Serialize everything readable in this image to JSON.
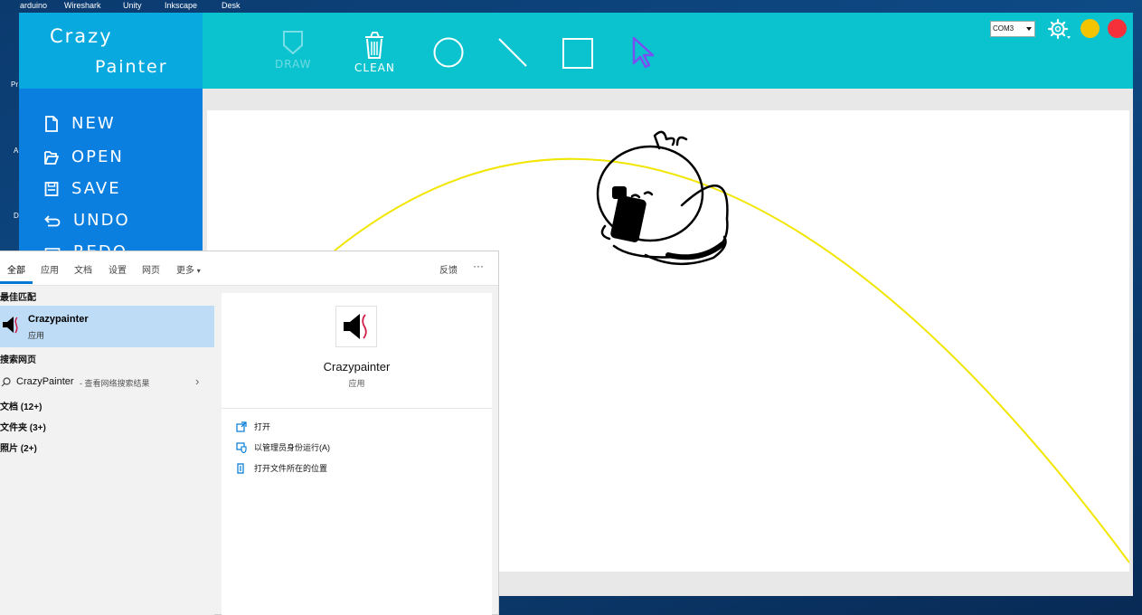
{
  "desktop": {
    "shortcuts": [
      "arduino",
      "Wireshark",
      "Unity",
      "Inkscape",
      "Desk"
    ],
    "edge_fragments": [
      "Pr",
      "A",
      "D"
    ]
  },
  "app": {
    "title_line1": "Crazy",
    "title_line2": "Painter",
    "tools": [
      {
        "label": "DRAW",
        "icon": "shield-icon",
        "enabled": false
      },
      {
        "label": "CLEAN",
        "icon": "trash-icon",
        "enabled": true
      },
      {
        "label": "",
        "icon": "circle-icon"
      },
      {
        "label": "",
        "icon": "line-icon"
      },
      {
        "label": "",
        "icon": "rectangle-icon"
      },
      {
        "label": "",
        "icon": "cursor-icon",
        "color": "#7a4ff0"
      }
    ],
    "port": "COM3",
    "window_dots": [
      "#f5c400",
      "#f5303a"
    ],
    "menu": [
      {
        "label": "NEW",
        "icon": "new-file-icon"
      },
      {
        "label": "OPEN",
        "icon": "open-folder-icon"
      },
      {
        "label": "SAVE",
        "icon": "save-icon"
      },
      {
        "label": "UNDO",
        "icon": "undo-icon"
      },
      {
        "label": "REDO",
        "icon": "redo-icon"
      }
    ],
    "colors": {
      "topbar": "#0bc3cf",
      "sidebar": "#0a7fe0",
      "logo": "#08a9df",
      "arc": "#f2e600"
    }
  },
  "search": {
    "tabs": [
      "全部",
      "应用",
      "文档",
      "设置",
      "网页",
      "更多"
    ],
    "feedback": "反馈",
    "more_dots": "···",
    "best_match_title": "最佳匹配",
    "best_match": {
      "name": "Crazypainter",
      "type": "应用"
    },
    "web_title": "搜索网页",
    "web_query": "CrazyPainter",
    "web_hint": " - 查看网络搜索结果",
    "categories": [
      "文档 (12+)",
      "文件夹 (3+)",
      "照片 (2+)"
    ],
    "detail": {
      "name": "Crazypainter",
      "type": "应用"
    },
    "actions": [
      "打开",
      "以管理员身份运行(A)",
      "打开文件所在的位置"
    ]
  }
}
